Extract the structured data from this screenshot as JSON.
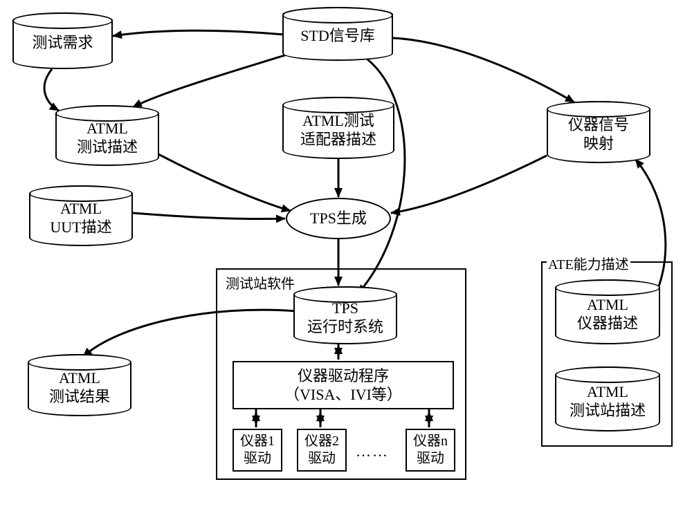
{
  "nodes": {
    "test_req": "测试需求",
    "std_lib": "STD信号库",
    "atml_test_desc_l1": "ATML",
    "atml_test_desc_l2": "测试描述",
    "atml_adapter_l1": "ATML测试",
    "atml_adapter_l2": "适配器描述",
    "instr_map_l1": "仪器信号",
    "instr_map_l2": "映射",
    "atml_uut_l1": "ATML",
    "atml_uut_l2": "UUT描述",
    "tps_gen": "TPS生成",
    "test_station_sw": "测试站软件",
    "tps_run_l1": "TPS",
    "tps_run_l2": "运行时系统",
    "atml_result_l1": "ATML",
    "atml_result_l2": "测试结果",
    "driver_prog_l1": "仪器驱动程序",
    "driver_prog_l2": "（VISA、IVI等）",
    "instr1_l1": "仪器1",
    "instr1_l2": "驱动",
    "instr2_l1": "仪器2",
    "instr2_l2": "驱动",
    "instrn_l1": "仪器n",
    "instrn_l2": "驱动",
    "dots": "……",
    "ate_cap": "ATE能力描述",
    "atml_instr_l1": "ATML",
    "atml_instr_l2": "仪器描述",
    "atml_station_l1": "ATML",
    "atml_station_l2": "测试站描述"
  }
}
